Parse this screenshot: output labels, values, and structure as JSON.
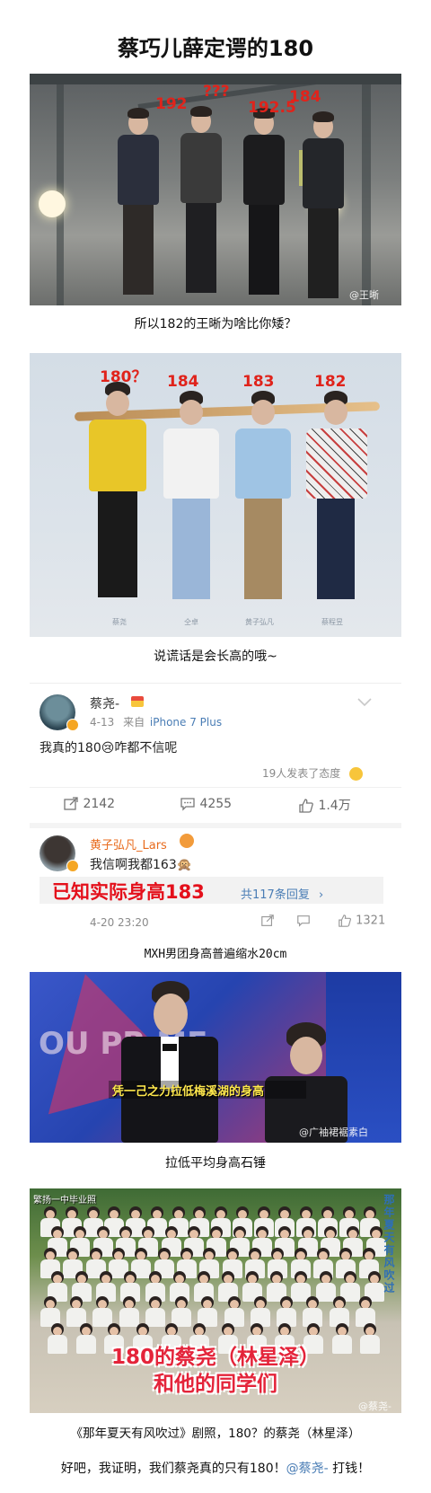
{
  "title": "蔡巧儿薛定谔的180",
  "photo1": {
    "labels": [
      "192",
      "???",
      "192.5",
      "184"
    ],
    "watermark": "@王晰",
    "caption": "所以182的王晰为啥比你矮？"
  },
  "photo2": {
    "labels": [
      "180？",
      "184",
      "183",
      "182"
    ],
    "names": [
      "蔡尧",
      "仝卓",
      "黄子弘凡",
      "蔡程昱"
    ],
    "caption": "说谎话是会长高的哦~"
  },
  "weibo_post": {
    "username": "蔡尧-",
    "date": "4-13",
    "source_prefix": "来自",
    "source": "iPhone 7 Plus",
    "text": "我真的180😢咋都不信呢",
    "reactions": "19人发表了态度",
    "forward_count": "2142",
    "comment_count": "4255",
    "like_count": "1.4万"
  },
  "weibo_comment": {
    "username": "黄子弘凡_Lars",
    "text": "我信啊我都163🙊",
    "overlay": "已知实际身高183",
    "replies": "共117条回复",
    "date": "4-20 23:20",
    "like_count": "1321"
  },
  "caption3": "MXH男团身高普遍缩水20cm",
  "photo3": {
    "subtitle": "凭一己之力拉低梅溪湖的身高",
    "watermark": "@广袖裙裾素白",
    "caption": "拉低平均身高石锤"
  },
  "photo4": {
    "corner_label": "繁扬一中毕业照",
    "vertical_text": "那年夏天有风吹过",
    "overlay_line1": "180的蔡尧（林星泽）",
    "overlay_line2": "和他的同学们",
    "watermark": "@蔡尧-",
    "caption": "《那年夏天有风吹过》剧照，180？的蔡尧（林星泽）"
  },
  "footer": {
    "text_before": "好吧，我证明，我们蔡尧真的只有180！",
    "mention": "@蔡尧-",
    "text_after": " 打钱！"
  },
  "colors": {
    "label_red": "#e0231b",
    "mention_blue": "#4a7db5",
    "vip_orange": "#e86b1d"
  }
}
